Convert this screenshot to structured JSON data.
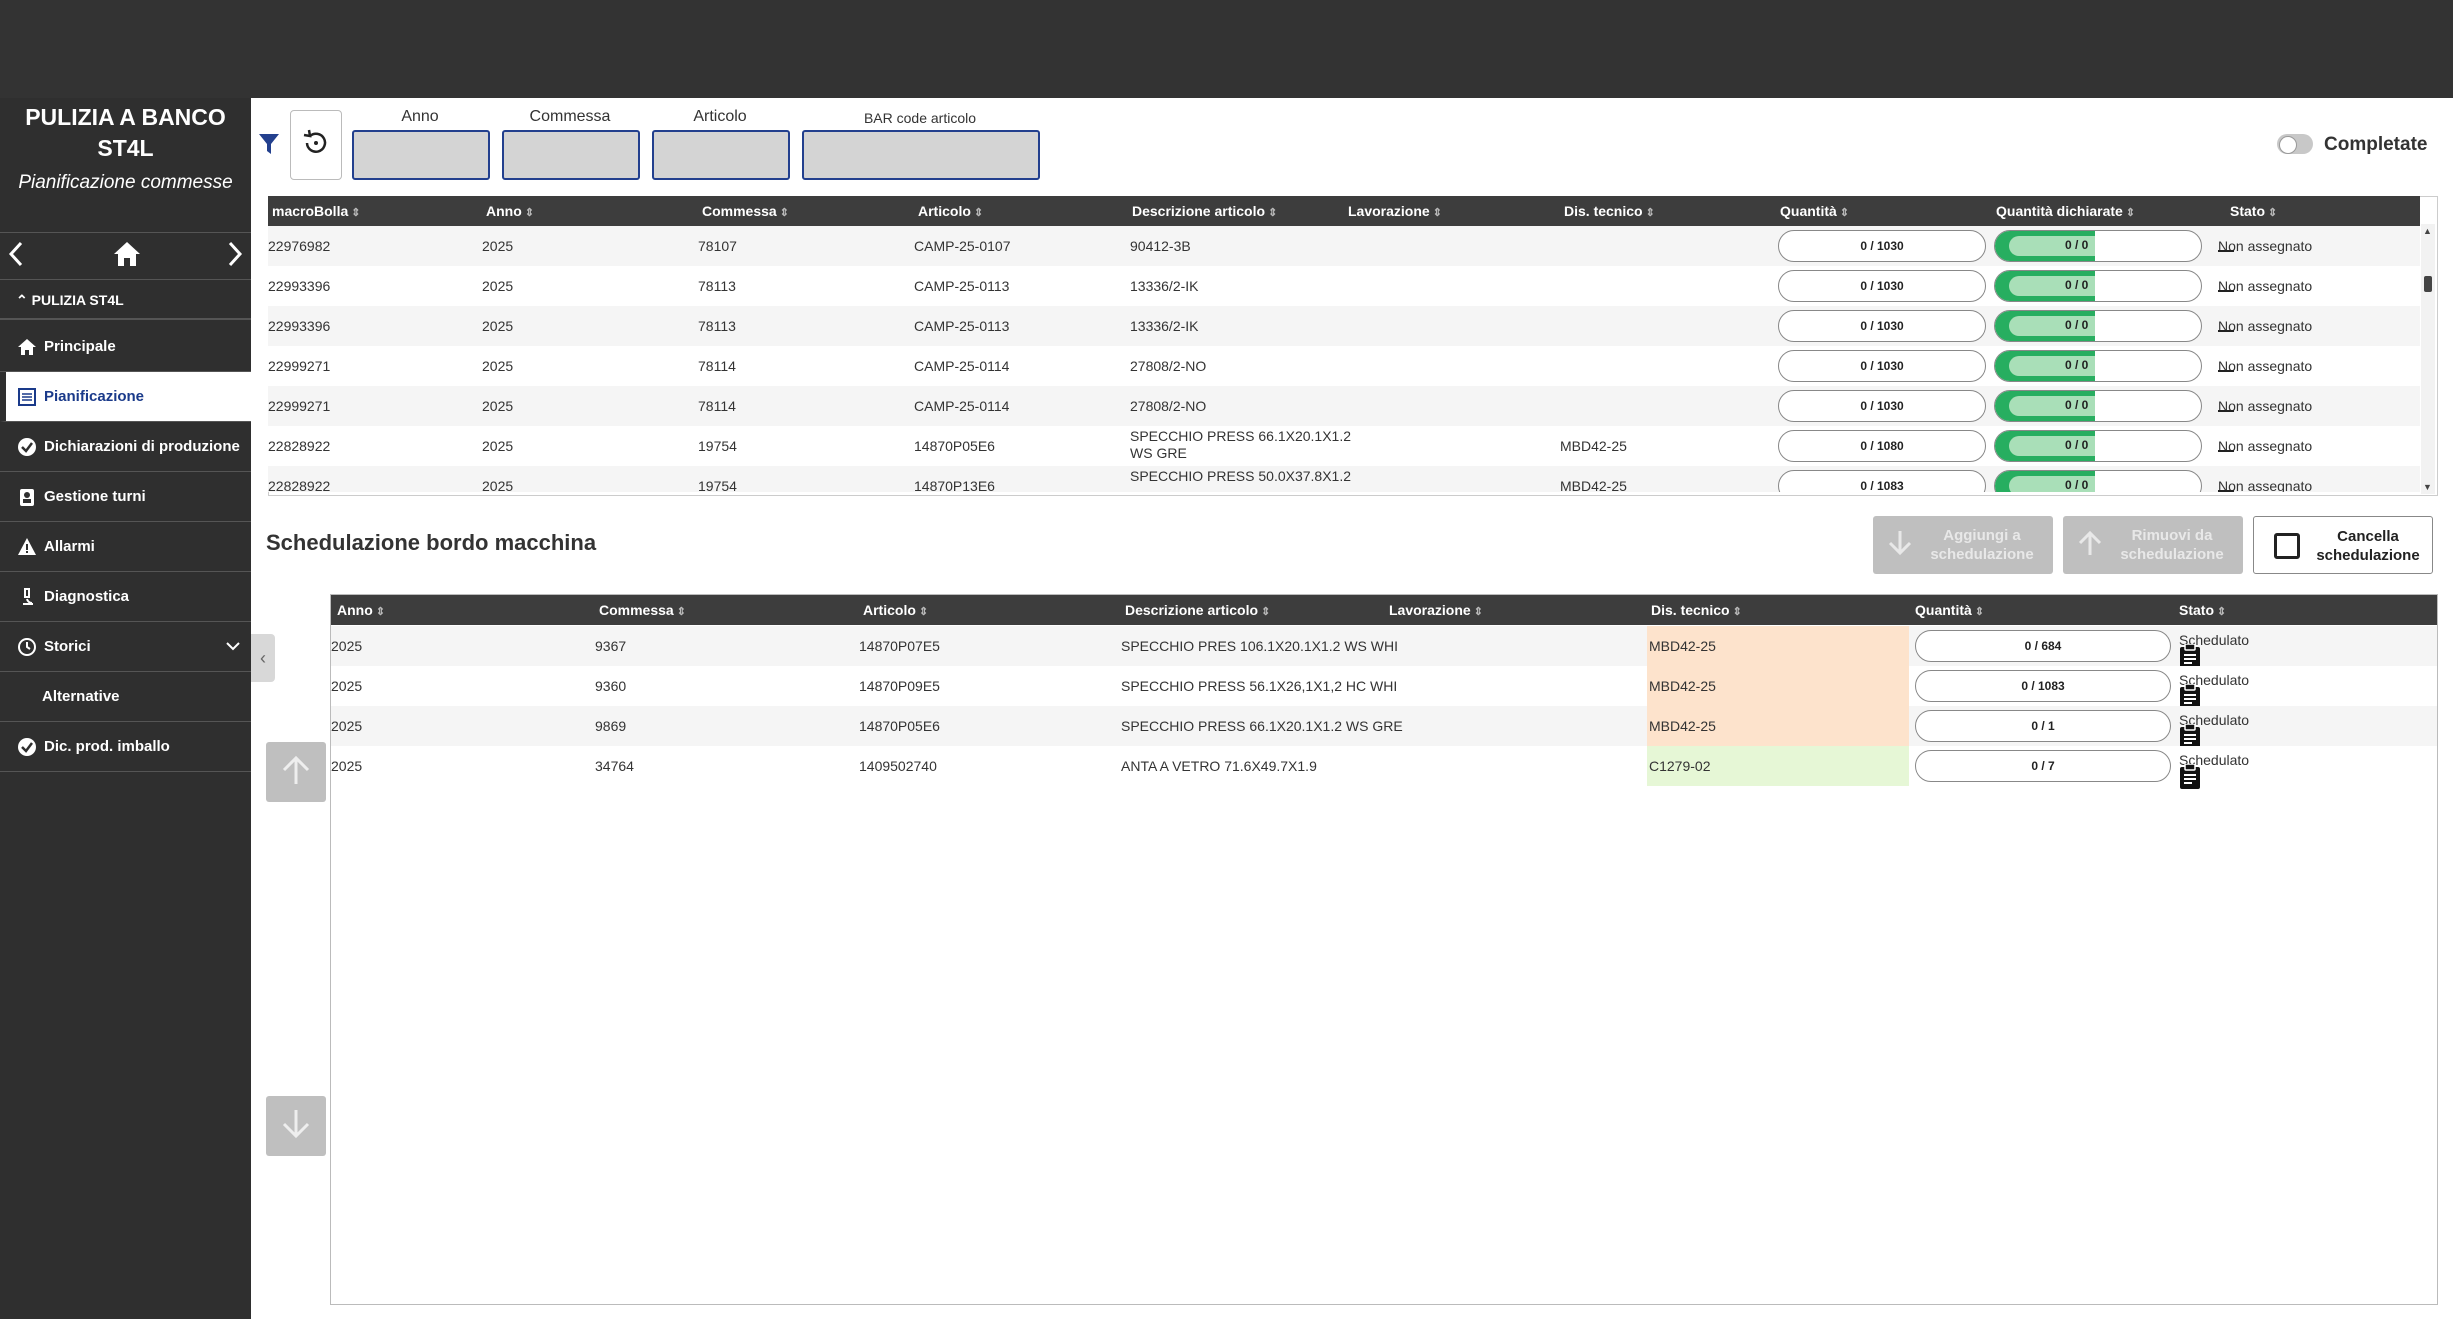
{
  "sidebar": {
    "title_line1": "PULIZIA A BANCO",
    "title_line2": "ST4L",
    "subtitle": "Pianificazione commesse",
    "group": "PULIZIA ST4L",
    "items": [
      {
        "label": "Principale"
      },
      {
        "label": "Pianificazione"
      },
      {
        "label": "Dichiarazioni di produzione"
      },
      {
        "label": "Gestione turni"
      },
      {
        "label": "Allarmi"
      },
      {
        "label": "Diagnostica"
      },
      {
        "label": "Storici"
      },
      {
        "label": "Alternative"
      },
      {
        "label": "Dic. prod. imballo"
      }
    ]
  },
  "filters": {
    "anno_label": "Anno",
    "commessa_label": "Commessa",
    "articolo_label": "Articolo",
    "barcode_label": "BAR code articolo",
    "completate_label": "Completate"
  },
  "table1": {
    "headers": [
      "macroBolla",
      "Anno",
      "Commessa",
      "Articolo",
      "Descrizione articolo",
      "Lavorazione",
      "Dis. tecnico",
      "Quantità",
      "Quantità dichiarate",
      "Stato"
    ],
    "rows": [
      {
        "macro": "22976982",
        "anno": "2025",
        "commessa": "78107",
        "articolo": "CAMP-25-0107",
        "desc1": "90412-3B",
        "desc2": "",
        "lav": "",
        "dis": "",
        "qty": "0 / 1030",
        "decl": "0 / 0",
        "stato": "Non assegnato"
      },
      {
        "macro": "22993396",
        "anno": "2025",
        "commessa": "78113",
        "articolo": "CAMP-25-0113",
        "desc1": "13336/2-IK",
        "desc2": "",
        "lav": "",
        "dis": "",
        "qty": "0 / 1030",
        "decl": "0 / 0",
        "stato": "Non assegnato"
      },
      {
        "macro": "22993396",
        "anno": "2025",
        "commessa": "78113",
        "articolo": "CAMP-25-0113",
        "desc1": "13336/2-IK",
        "desc2": "",
        "lav": "",
        "dis": "",
        "qty": "0 / 1030",
        "decl": "0 / 0",
        "stato": "Non assegnato"
      },
      {
        "macro": "22999271",
        "anno": "2025",
        "commessa": "78114",
        "articolo": "CAMP-25-0114",
        "desc1": "27808/2-NO",
        "desc2": "",
        "lav": "",
        "dis": "",
        "qty": "0 / 1030",
        "decl": "0 / 0",
        "stato": "Non assegnato"
      },
      {
        "macro": "22999271",
        "anno": "2025",
        "commessa": "78114",
        "articolo": "CAMP-25-0114",
        "desc1": "27808/2-NO",
        "desc2": "",
        "lav": "",
        "dis": "",
        "qty": "0 / 1030",
        "decl": "0 / 0",
        "stato": "Non assegnato"
      },
      {
        "macro": "22828922",
        "anno": "2025",
        "commessa": "19754",
        "articolo": "14870P05E6",
        "desc1": "SPECCHIO PRESS 66.1X20.1X1.2",
        "desc2": "WS GRE",
        "lav": "",
        "dis": "MBD42-25",
        "qty": "0 / 1080",
        "decl": "0 / 0",
        "stato": "Non assegnato"
      },
      {
        "macro": "22828922",
        "anno": "2025",
        "commessa": "19754",
        "articolo": "14870P13E6",
        "desc1": "SPECCHIO PRESS 50.0X37.8X1.2",
        "desc2": "",
        "lav": "",
        "dis": "MBD42-25",
        "qty": "0 / 1083",
        "decl": "0 / 0",
        "stato": "Non assegnato"
      }
    ]
  },
  "schedule": {
    "title": "Schedulazione bordo macchina",
    "add_label": "Aggiungi a schedulazione",
    "remove_label": "Rimuovi da schedulazione",
    "clear_label": "Cancella schedulazione",
    "headers": [
      "Anno",
      "Commessa",
      "Articolo",
      "Descrizione articolo",
      "Lavorazione",
      "Dis. tecnico",
      "Quantità",
      "Stato"
    ],
    "rows": [
      {
        "anno": "2025",
        "commessa": "9367",
        "articolo": "14870P07E5",
        "desc": "SPECCHIO PRES 106.1X20.1X1.2 WS WHI",
        "lav": "",
        "dis": "MBD42-25",
        "qty": "0 / 684",
        "stato": "Schedulato"
      },
      {
        "anno": "2025",
        "commessa": "9360",
        "articolo": "14870P09E5",
        "desc": "SPECCHIO PRESS 56.1X26,1X1,2 HC WHI",
        "lav": "",
        "dis": "MBD42-25",
        "qty": "0 / 1083",
        "stato": "Schedulato"
      },
      {
        "anno": "2025",
        "commessa": "9869",
        "articolo": "14870P05E6",
        "desc": "SPECCHIO PRESS 66.1X20.1X1.2 WS GRE",
        "lav": "",
        "dis": "MBD42-25",
        "qty": "0 / 1",
        "stato": "Schedulato"
      },
      {
        "anno": "2025",
        "commessa": "34764",
        "articolo": "1409502740",
        "desc": "ANTA A VETRO 71.6X49.7X1.9",
        "lav": "",
        "dis": "C1279-02",
        "qty": "0 / 7",
        "stato": "Schedulato"
      }
    ]
  },
  "colors": {
    "accent": "#23408e",
    "dis_orange": "#fde3cc",
    "dis_green": "#e6f7d6",
    "progress_green": "#27ae60"
  },
  "icons": [
    "chevron-left-icon",
    "home-icon",
    "chevron-right-icon",
    "filter-icon",
    "reset-icon",
    "arrow-up-icon",
    "arrow-down-icon",
    "clipboard-icon"
  ]
}
